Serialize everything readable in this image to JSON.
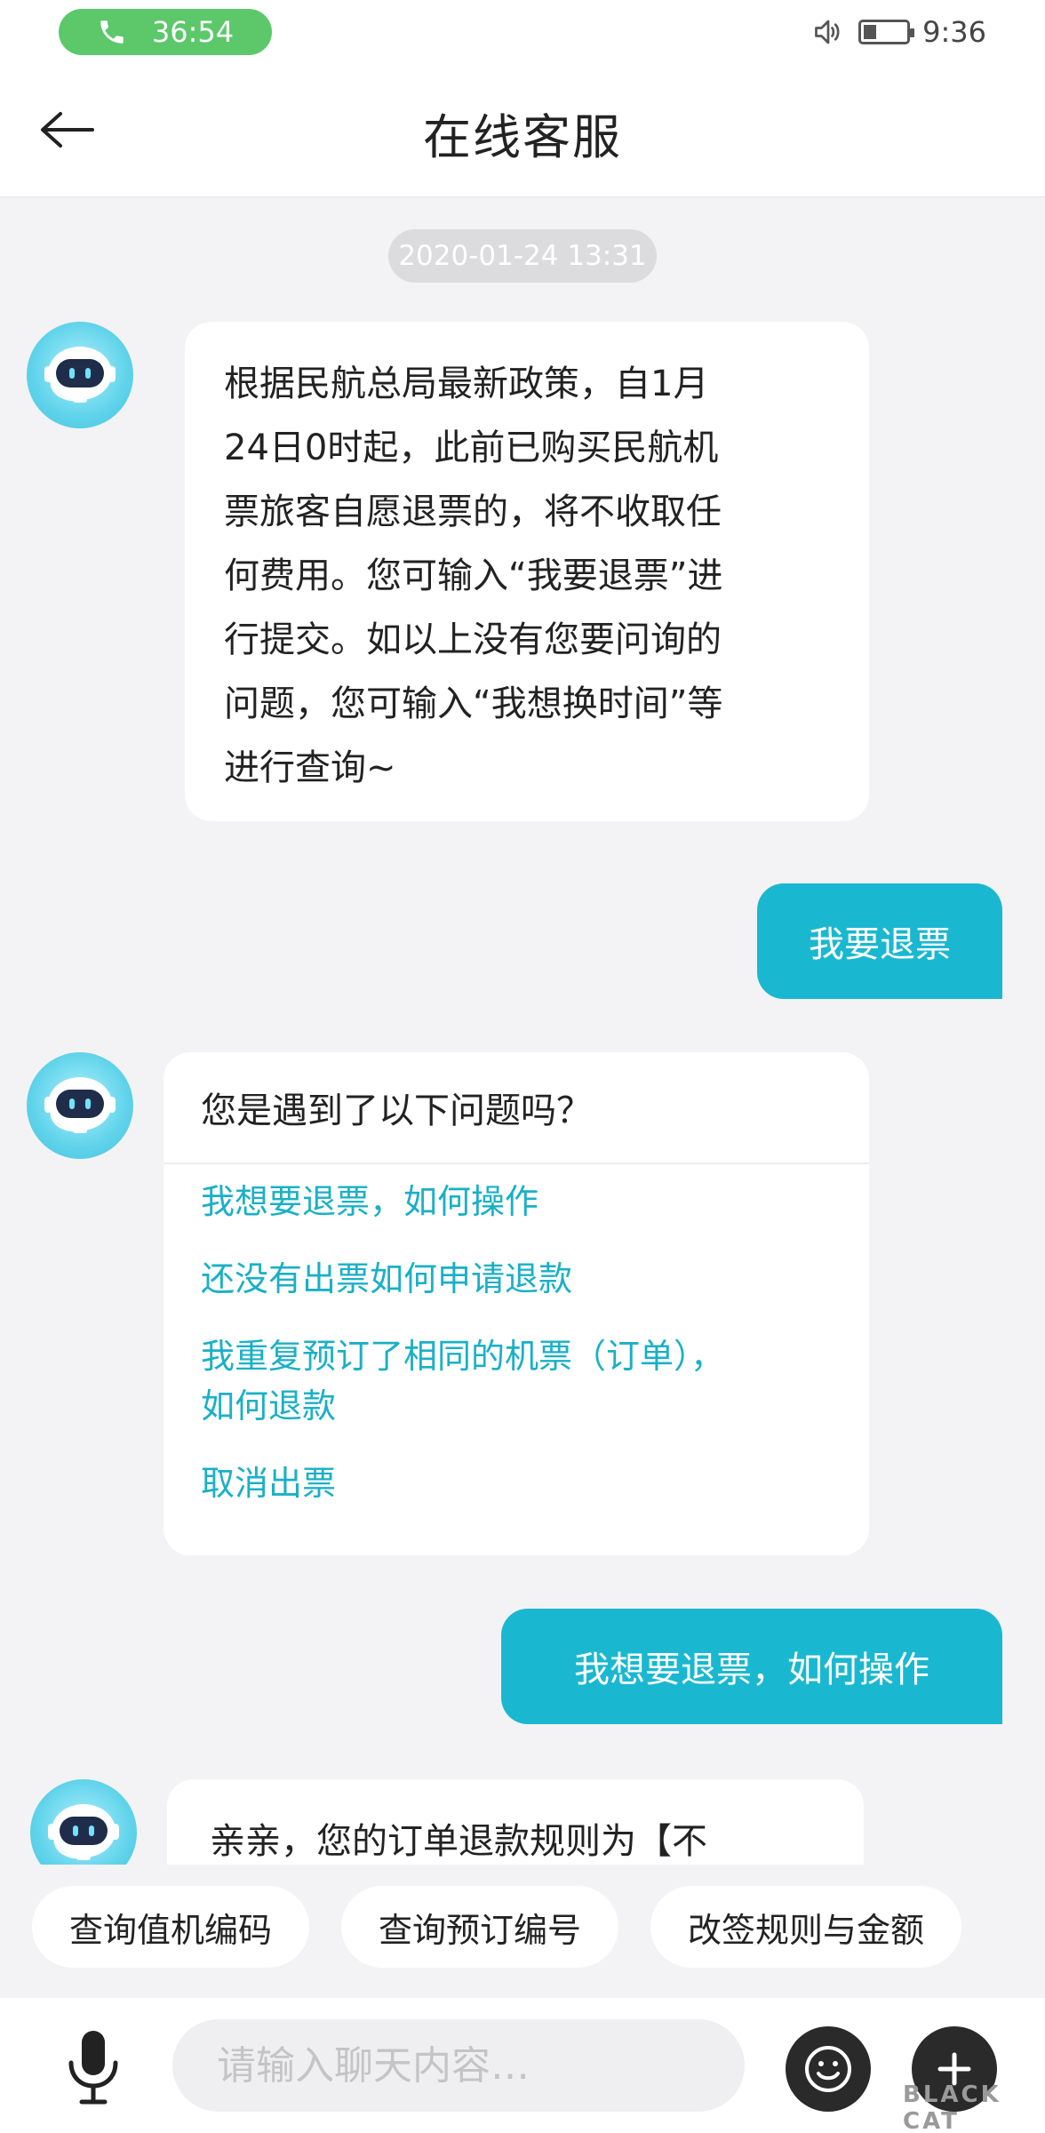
{
  "status_bar": {
    "call_duration": "36:54",
    "time": "9:36"
  },
  "header": {
    "title": "在线客服"
  },
  "chat": {
    "timestamp": "2020-01-24 13:31",
    "messages": [
      {
        "sender": "bot",
        "text": "根据民航总局最新政策，自1月\n24日0时起，此前已购买民航机\n票旅客自愿退票的，将不收取任\n何费用。您可输入“我要退票”进\n行提交。如以上没有您要问询的\n问题，您可输入“我想换时间”等\n进行查询~"
      },
      {
        "sender": "user",
        "text": "我要退票"
      },
      {
        "sender": "bot",
        "question": "您是遇到了以下问题吗？",
        "options": [
          "我想要退票，如何操作",
          "还没有出票如何申请退款",
          "我重复预订了相同的机票（订单），\n如何退款",
          "取消出票"
        ]
      },
      {
        "sender": "user",
        "text": "我想要退票，如何操作"
      },
      {
        "sender": "bot",
        "text": "亲亲，您的订单退款规则为【不"
      }
    ]
  },
  "quick_replies": [
    "查询值机编码",
    "查询预订编号",
    "改签规则与金额"
  ],
  "input": {
    "placeholder": "请输入聊天内容…"
  },
  "watermark": {
    "text": "BLACK CAT"
  },
  "colors": {
    "accent": "#1ab8d0",
    "link": "#1ab0c6",
    "call_pill": "#5cc86a",
    "background": "#f3f3f5"
  },
  "icons": {
    "call": "phone-icon",
    "speaker": "speaker-icon",
    "battery": "battery-icon",
    "back": "back-arrow-icon",
    "avatar": "robot-icon",
    "mic": "microphone-icon",
    "emoji": "emoji-icon",
    "plus": "plus-icon"
  }
}
